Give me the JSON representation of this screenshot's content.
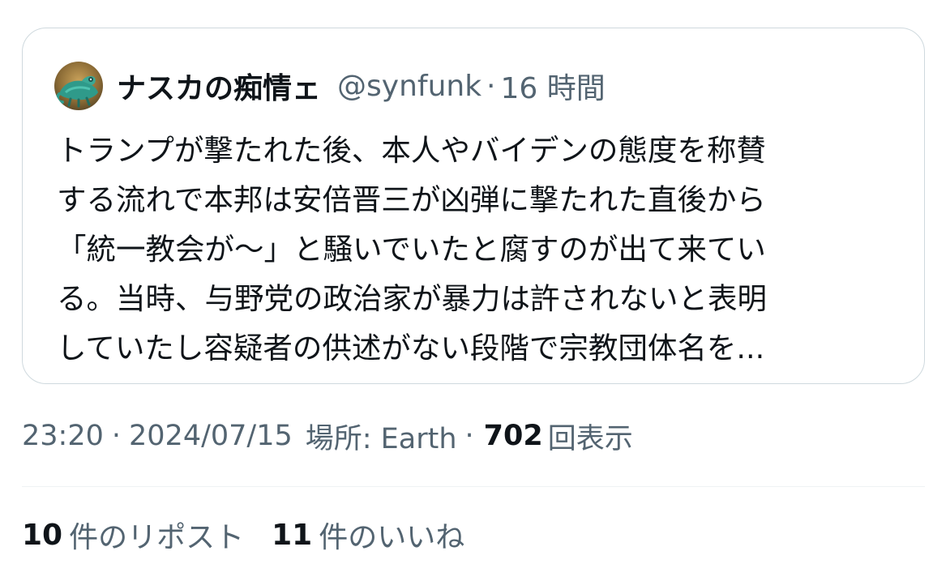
{
  "quoted_tweet": {
    "display_name": "ナスカの痴情ェ",
    "handle": "@synfunk",
    "separator": "·",
    "time_ago": "16 時間",
    "text": "トランプが撃たれた後、本人やバイデンの態度を称賛\nする流れで本邦は安倍晋三が凶弾に撃たれた直後から\n「統一教会が〜」と騒いでいたと腐すのが出て来てい\nる。当時、与野党の政治家が暴力は許されないと表明\nしていたし容疑者の供述がない段階で宗教団体名を...",
    "avatar_icon": "chameleon-avatar"
  },
  "meta": {
    "time": "23:20",
    "dot": "·",
    "date": "2024/07/15",
    "location_label": "場所: Earth",
    "dot2": "·",
    "views_count": "702",
    "views_label": "回表示"
  },
  "stats": {
    "reposts_count": "10",
    "reposts_label": "件のリポスト",
    "likes_count": "11",
    "likes_label": "件のいいね"
  },
  "colors": {
    "text_primary": "#0f1419",
    "text_secondary": "#536471",
    "border": "#cfd9de",
    "divider": "#eff3f4",
    "background": "#ffffff"
  }
}
